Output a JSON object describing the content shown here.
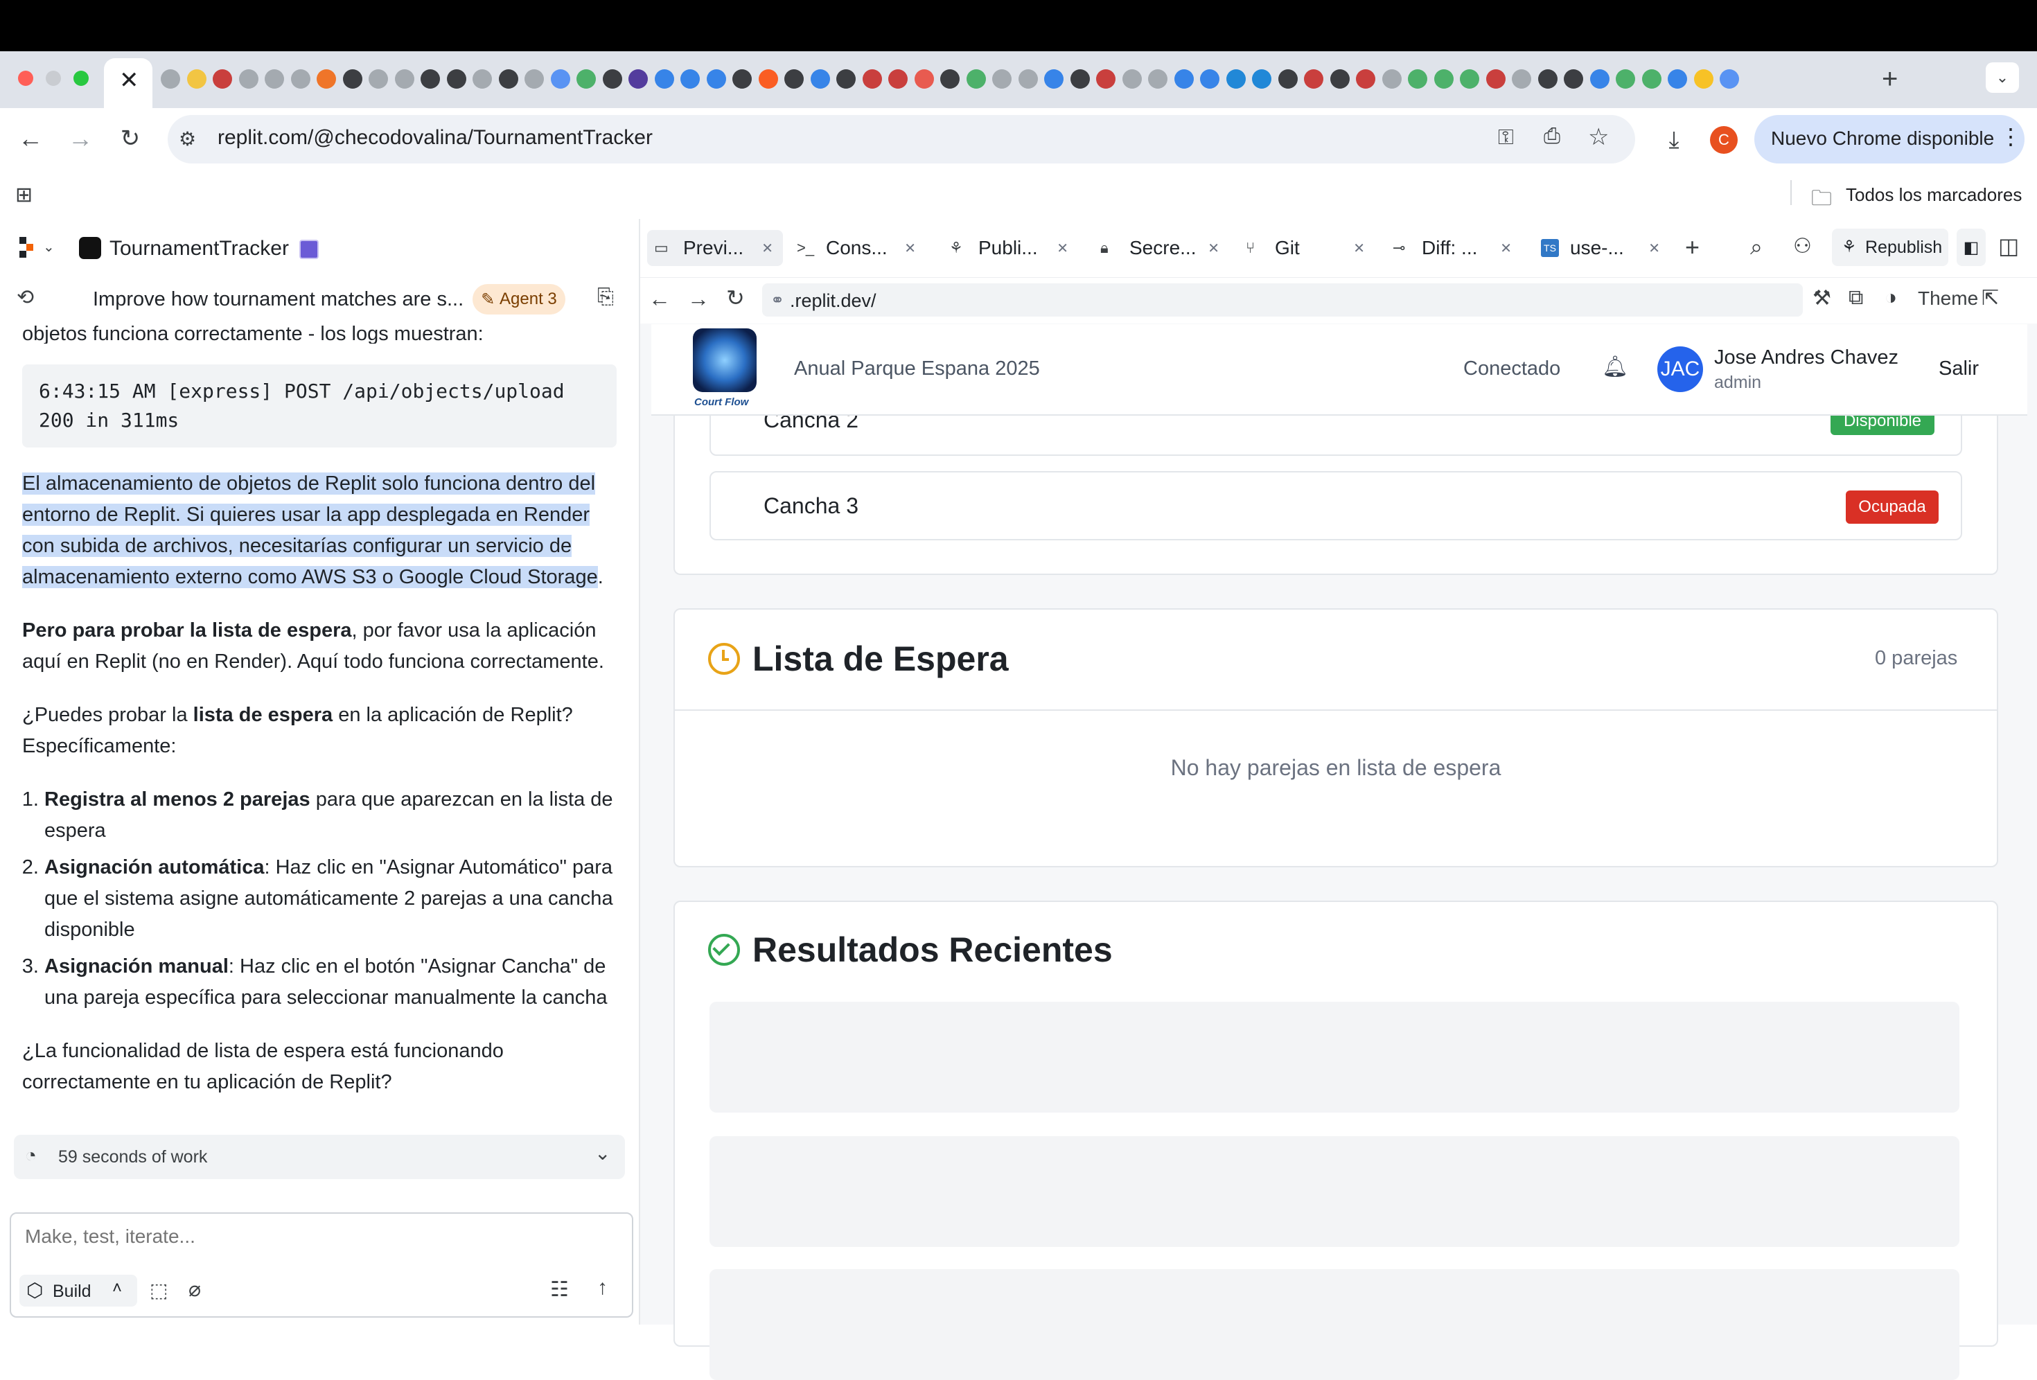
{
  "browser": {
    "url": "replit.com/@checodovalina/TournamentTracker",
    "new_chrome_label": "Nuevo Chrome disponible",
    "profile_initial": "C",
    "bookmarks_label": "Todos los marcadores",
    "colors": {
      "accent": "#1a73e8",
      "profile": "#e8501f"
    }
  },
  "workspace": {
    "project_name": "TournamentTracker",
    "thread_title": "Improve how tournament matches are s...",
    "agent_badge": "Agent 3",
    "tabs": [
      {
        "label": "Previ...",
        "icon": "monitor-icon"
      },
      {
        "label": "Cons...",
        "icon": "terminal-icon"
      },
      {
        "label": "Publi...",
        "icon": "publish-icon"
      },
      {
        "label": "Secre...",
        "icon": "lock-icon"
      },
      {
        "label": "Git",
        "icon": "git-icon"
      },
      {
        "label": "Diff: ...",
        "icon": "commit-icon"
      },
      {
        "label": "use-...",
        "icon": "ts-file-icon"
      }
    ],
    "republish_label": "Republish"
  },
  "chat": {
    "intro_fragment": "objetos funciona correctamente - los logs muestran:",
    "code_lines": [
      "6:43:15 AM [express] POST /api/objects/upload",
      "200 in 311ms"
    ],
    "para1_selected": "El almacenamiento de objetos de Replit solo funciona dentro del entorno de Replit. Si quieres usar la app desplegada en Render con subida de archivos, necesitarías configurar un servicio de almacenamiento externo como AWS S3 o Google Cloud Storage",
    "para1_end": ".",
    "para2_bold": "Pero para probar la lista de espera",
    "para2_rest": ", por favor usa la aplicación aquí en Replit (no en Render). Aquí todo funciona correctamente.",
    "para3_a": "¿Puedes probar la ",
    "para3_bold": "lista de espera",
    "para3_b": " en la aplicación de Replit? Específicamente:",
    "list": [
      {
        "bold": "Registra al menos 2 parejas",
        "rest": " para que aparezcan en la lista de espera"
      },
      {
        "bold": "Asignación automática",
        "rest": ": Haz clic en \"Asignar Automático\" para que el sistema asigne automáticamente 2 parejas a una cancha disponible"
      },
      {
        "bold": "Asignación manual",
        "rest": ": Haz clic en el botón \"Asignar Cancha\" de una pareja específica para seleccionar manualmente la cancha"
      }
    ],
    "closing": "¿La funcionalidad de lista de espera está funcionando correctamente en tu aplicación de Replit?",
    "work_summary": "59 seconds of work",
    "input_placeholder": "Make, test, iterate...",
    "build_label": "Build"
  },
  "preview": {
    "url": ".replit.dev/",
    "theme_label": "Theme",
    "app": {
      "logo_text": "Court Flow",
      "tournament": "Anual Parque Espana 2025",
      "status": "Conectado",
      "user_initials": "JAC",
      "user_name": "Jose Andres Chavez",
      "user_role": "admin",
      "logout": "Salir",
      "courts": [
        {
          "name": "Cancha 2",
          "status": "Disponible",
          "color": "#34a853"
        },
        {
          "name": "Cancha 3",
          "status": "Ocupada",
          "color": "#d93025"
        }
      ],
      "waitlist_title": "Lista de Espera",
      "waitlist_count": "0 parejas",
      "waitlist_empty": "No hay parejas en lista de espera",
      "results_title": "Resultados Recientes"
    }
  }
}
